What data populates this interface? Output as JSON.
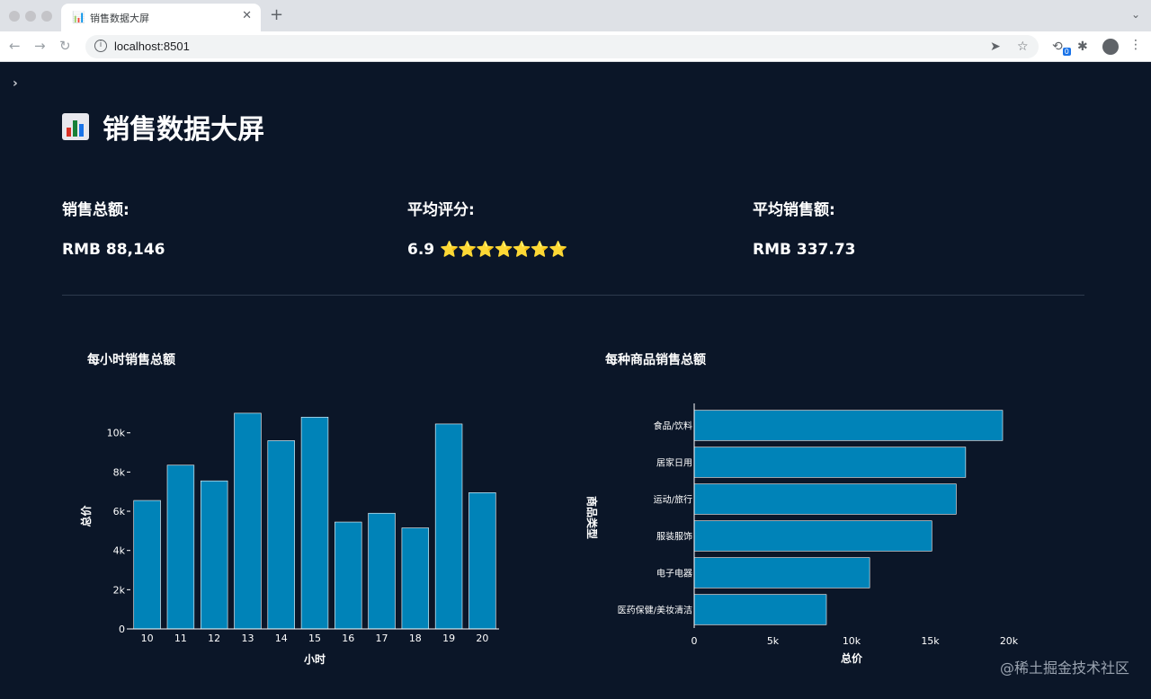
{
  "browser": {
    "tab_title": "销售数据大屏",
    "tab_icon": "📊",
    "url": "localhost:8501",
    "extension_badge": "0"
  },
  "page": {
    "title_icon": "bar-chart-emoji",
    "title": "销售数据大屏",
    "metrics": [
      {
        "label": "销售总额:",
        "value": "RMB 88,146"
      },
      {
        "label": "平均评分:",
        "value": "6.9",
        "stars": "⭐⭐⭐⭐⭐⭐⭐"
      },
      {
        "label": "平均销售额:",
        "value": "RMB 337.73"
      }
    ],
    "watermark": "@稀土掘金技术社区"
  },
  "chart_data": [
    {
      "type": "bar",
      "title": "每小时销售总额",
      "xlabel": "小时",
      "ylabel": "总价",
      "categories": [
        "10",
        "11",
        "12",
        "13",
        "14",
        "15",
        "16",
        "17",
        "18",
        "19",
        "20"
      ],
      "values": [
        6550,
        8350,
        7550,
        11000,
        9600,
        10800,
        5450,
        5900,
        5150,
        10450,
        6950
      ],
      "ylim": [
        0,
        11500
      ],
      "yticks": [
        0,
        2000,
        4000,
        6000,
        8000,
        10000
      ],
      "ytick_labels": [
        "0",
        "2k",
        "4k",
        "6k",
        "8k",
        "10k"
      ],
      "color": "#0083b8"
    },
    {
      "type": "bar",
      "orientation": "horizontal",
      "title": "每种商品销售总额",
      "xlabel": "总价",
      "ylabel": "商品类型",
      "categories": [
        "食品/饮料",
        "居家日用",
        "运动/旅行",
        "服装服饰",
        "电子电器",
        "医药保健/美妆清洁"
      ],
      "values": [
        19600,
        17250,
        16650,
        15100,
        11150,
        8400
      ],
      "xlim": [
        0,
        20000
      ],
      "xticks": [
        0,
        5000,
        10000,
        15000,
        20000
      ],
      "xtick_labels": [
        "0",
        "5k",
        "10k",
        "15k",
        "20k"
      ],
      "color": "#0083b8"
    }
  ]
}
